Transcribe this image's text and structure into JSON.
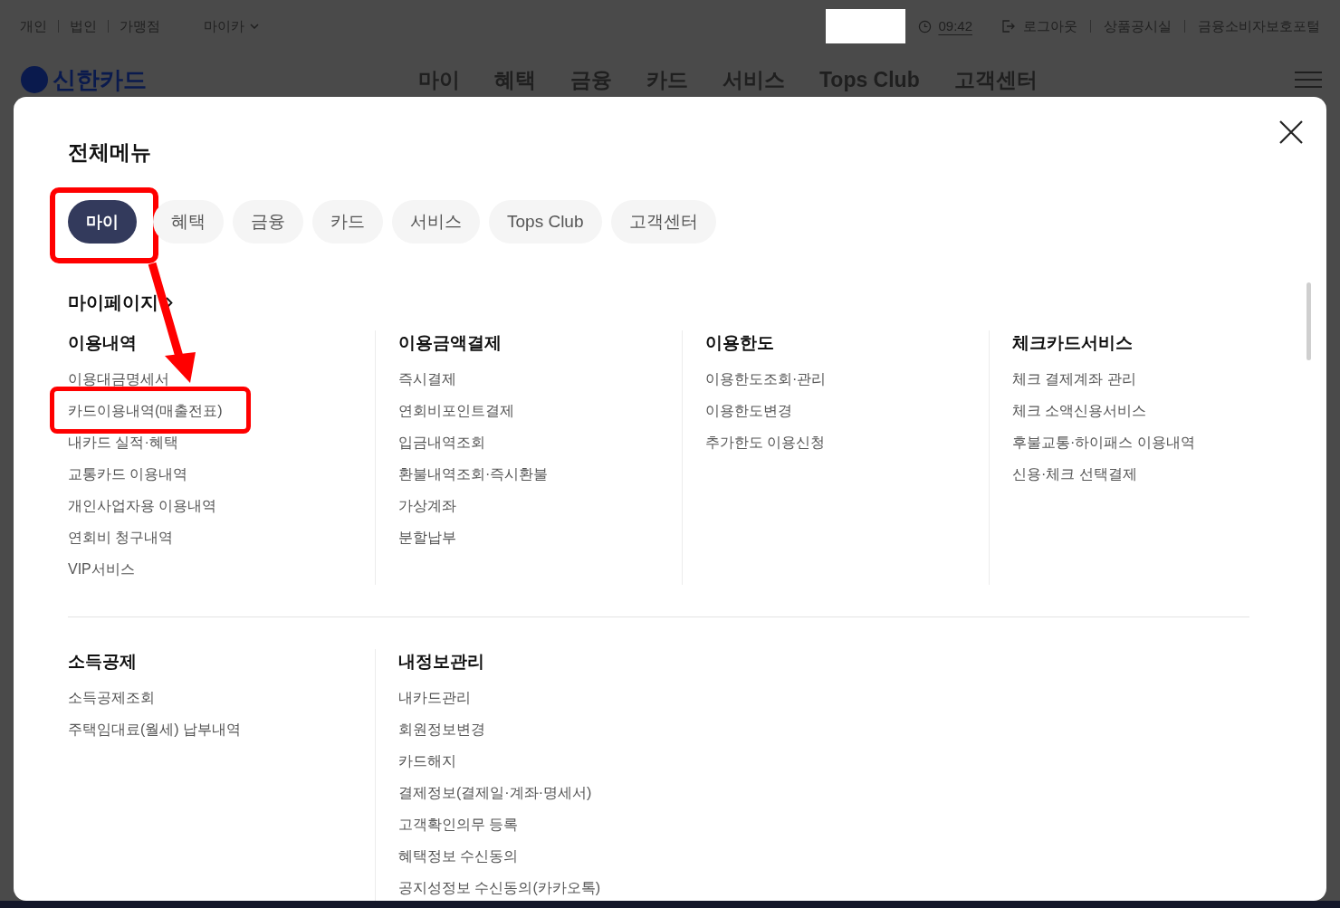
{
  "header": {
    "audience_links": [
      "개인",
      "법인",
      "가맹점"
    ],
    "user_menu": "마이카",
    "session_time": "09:42",
    "utility_links": [
      "로그아웃",
      "상품공시실",
      "금융소비자보호포털"
    ],
    "logo": "신한카드",
    "nav": [
      "마이",
      "혜택",
      "금융",
      "카드",
      "서비스",
      "Tops Club",
      "고객센터"
    ]
  },
  "menu": {
    "title": "전체메뉴",
    "tabs": [
      {
        "label": "마이",
        "selected": true,
        "highlighted": true
      },
      {
        "label": "혜택",
        "selected": false,
        "highlighted": false
      },
      {
        "label": "금융",
        "selected": false,
        "highlighted": false
      },
      {
        "label": "카드",
        "selected": false,
        "highlighted": false
      },
      {
        "label": "서비스",
        "selected": false,
        "highlighted": false
      },
      {
        "label": "Tops Club",
        "selected": false,
        "highlighted": false
      },
      {
        "label": "고객센터",
        "selected": false,
        "highlighted": false
      }
    ],
    "section_title": "마이페이지",
    "groups": [
      [
        {
          "heading": "이용내역",
          "items": [
            {
              "label": "이용대금명세서",
              "highlighted": false
            },
            {
              "label": "카드이용내역(매출전표)",
              "highlighted": true
            },
            {
              "label": "내카드 실적·혜택",
              "highlighted": false
            },
            {
              "label": "교통카드 이용내역",
              "highlighted": false
            },
            {
              "label": "개인사업자용 이용내역",
              "highlighted": false
            },
            {
              "label": "연회비 청구내역",
              "highlighted": false
            },
            {
              "label": "VIP서비스",
              "highlighted": false
            }
          ]
        },
        {
          "heading": "이용금액결제",
          "items": [
            {
              "label": "즉시결제",
              "highlighted": false
            },
            {
              "label": "연회비포인트결제",
              "highlighted": false
            },
            {
              "label": "입금내역조회",
              "highlighted": false
            },
            {
              "label": "환불내역조회·즉시환불",
              "highlighted": false
            },
            {
              "label": "가상계좌",
              "highlighted": false
            },
            {
              "label": "분할납부",
              "highlighted": false
            }
          ]
        },
        {
          "heading": "이용한도",
          "items": [
            {
              "label": "이용한도조회·관리",
              "highlighted": false
            },
            {
              "label": "이용한도변경",
              "highlighted": false
            },
            {
              "label": "추가한도 이용신청",
              "highlighted": false
            }
          ]
        },
        {
          "heading": "체크카드서비스",
          "items": [
            {
              "label": "체크 결제계좌 관리",
              "highlighted": false
            },
            {
              "label": "체크 소액신용서비스",
              "highlighted": false
            },
            {
              "label": "후불교통·하이패스 이용내역",
              "highlighted": false
            },
            {
              "label": "신용·체크 선택결제",
              "highlighted": false
            }
          ]
        }
      ],
      [
        {
          "heading": "소득공제",
          "items": [
            {
              "label": "소득공제조회",
              "highlighted": false
            },
            {
              "label": "주택임대료(월세) 납부내역",
              "highlighted": false
            }
          ]
        },
        {
          "heading": "내정보관리",
          "items": [
            {
              "label": "내카드관리",
              "highlighted": false
            },
            {
              "label": "회원정보변경",
              "highlighted": false
            },
            {
              "label": "카드해지",
              "highlighted": false
            },
            {
              "label": "결제정보(결제일·계좌·명세서)",
              "highlighted": false
            },
            {
              "label": "고객확인의무 등록",
              "highlighted": false
            },
            {
              "label": "혜택정보 수신동의",
              "highlighted": false
            },
            {
              "label": "공지성정보 수신동의(카카오톡)",
              "highlighted": false
            }
          ]
        }
      ]
    ]
  }
}
